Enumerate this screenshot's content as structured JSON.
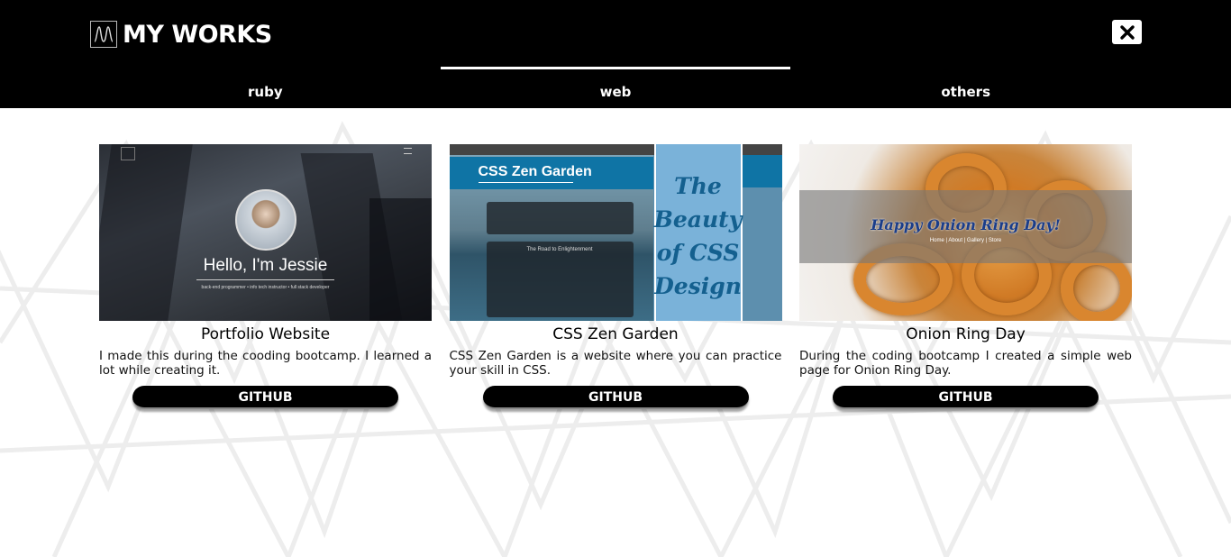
{
  "header": {
    "title": "MY WORKS",
    "logo_icon": "waveform-logo-icon",
    "close_icon": "close-icon"
  },
  "tabs": [
    {
      "label": "ruby",
      "active": false
    },
    {
      "label": "web",
      "active": true
    },
    {
      "label": "others",
      "active": false
    }
  ],
  "cards": [
    {
      "title": "Portfolio Website",
      "description": "I made this during the cooding bootcamp. I learned a lot while creating it.",
      "button_label": "GITHUB",
      "thumb": {
        "heading": "Hello, I'm Jessie",
        "subtitle": "back-end programmer • info tech instructor • full stack developer"
      }
    },
    {
      "title": "CSS Zen Garden",
      "description": "CSS Zen Garden is a website where you can practice your skill in CSS.",
      "button_label": "GITHUB",
      "thumb": {
        "heading": "CSS Zen Garden",
        "side_text": "The Beauty of CSS Design",
        "box_title": "The Road to Enlightenment"
      }
    },
    {
      "title": "Onion Ring Day",
      "description": "During the coding bootcamp I created a simple web page for Onion Ring Day.",
      "button_label": "GITHUB",
      "thumb": {
        "heading": "Happy Onion Ring Day!",
        "nav": "Home | About | Gallery | Store"
      }
    }
  ],
  "colors": {
    "header_bg": "#000000",
    "page_bg": "#ffffff",
    "button_bg": "#000000",
    "zen_blue": "#0f74a5"
  }
}
